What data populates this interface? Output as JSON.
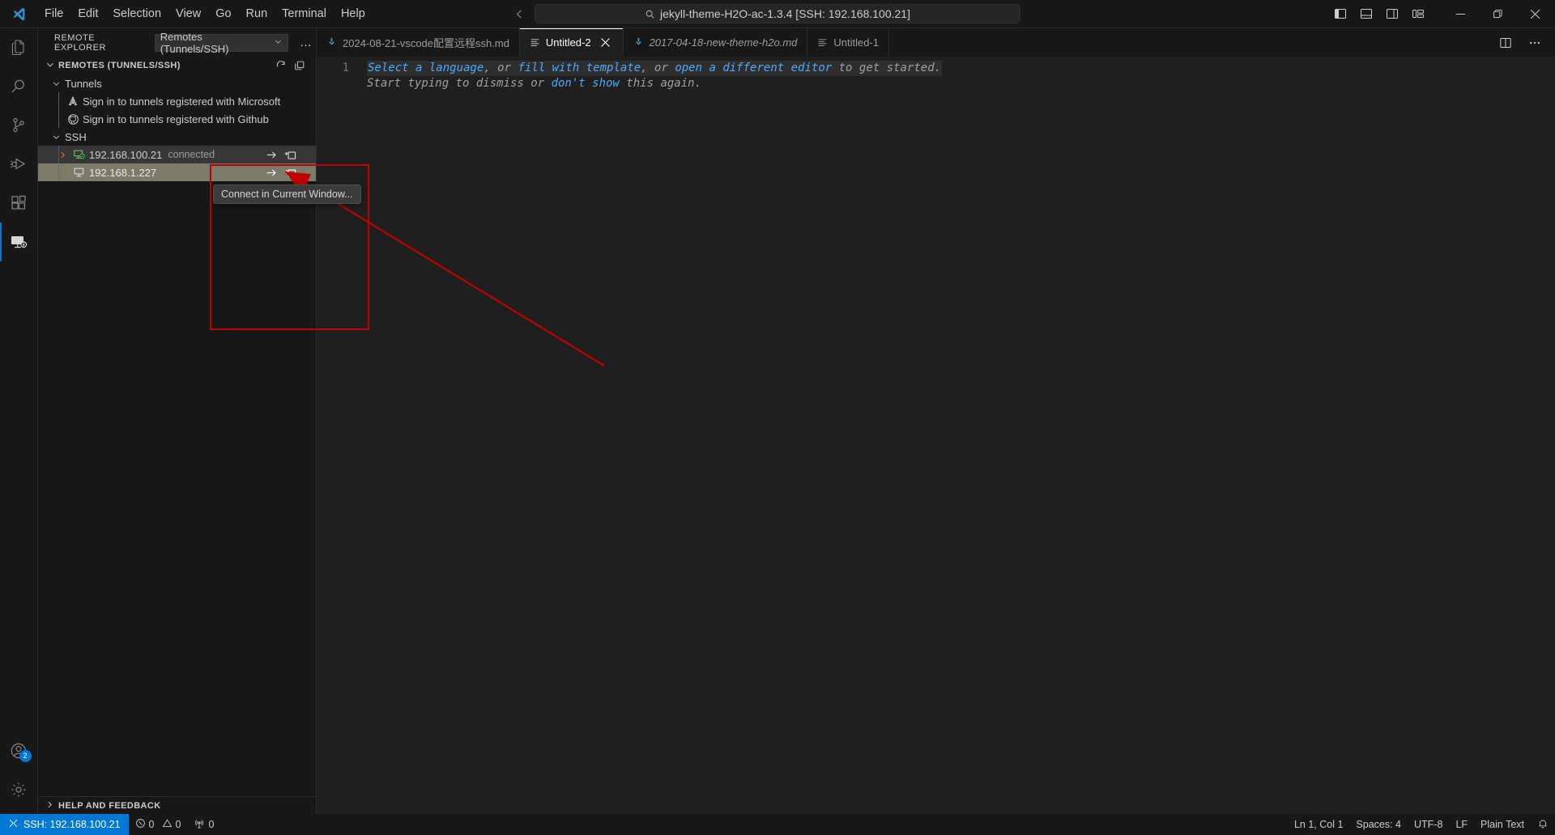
{
  "titlebar": {
    "logo": "vscode-logo",
    "menus": [
      "File",
      "Edit",
      "Selection",
      "View",
      "Go",
      "Run",
      "Terminal",
      "Help"
    ],
    "nav_back": "back-arrow-icon",
    "nav_forward": "forward-arrow-icon",
    "command_center": {
      "icon": "search-icon",
      "text": "jekyll-theme-H2O-ac-1.3.4 [SSH: 192.168.100.21]"
    },
    "layout_buttons": [
      "toggle-primary-sidebar-icon",
      "toggle-panel-icon",
      "toggle-secondary-sidebar-icon",
      "customize-layout-icon"
    ],
    "window_controls": [
      "minimize",
      "restore",
      "close"
    ]
  },
  "activitybar": {
    "items": [
      {
        "name": "explorer",
        "icon": "files-icon",
        "active": false
      },
      {
        "name": "search",
        "icon": "search-icon",
        "active": false
      },
      {
        "name": "source-control",
        "icon": "source-control-icon",
        "active": false
      },
      {
        "name": "run-and-debug",
        "icon": "run-debug-icon",
        "active": false
      },
      {
        "name": "extensions",
        "icon": "extensions-icon",
        "active": false
      },
      {
        "name": "remote-explorer",
        "icon": "remote-explorer-icon",
        "active": true
      }
    ],
    "bottom": [
      {
        "name": "accounts",
        "icon": "account-icon",
        "badge": "2"
      },
      {
        "name": "manage",
        "icon": "gear-icon",
        "badge": ""
      }
    ]
  },
  "sidebar": {
    "title": "REMOTE EXPLORER",
    "dropdown_label": "Remotes (Tunnels/SSH)",
    "dropdown_chevron": "chevron-down-icon",
    "more_actions": "…",
    "section": {
      "title": "REMOTES (TUNNELS/SSH)",
      "chevron": "chevron-down-icon",
      "actions": [
        "refresh-icon",
        "new-remote-icon"
      ]
    },
    "groups": [
      {
        "label": "Tunnels",
        "chevron": "chevron-down-icon",
        "children": [
          {
            "label": "Sign in to tunnels registered with Microsoft",
            "icon": "microsoft-icon"
          },
          {
            "label": "Sign in to tunnels registered with Github",
            "icon": "github-icon"
          }
        ]
      },
      {
        "label": "SSH",
        "chevron": "chevron-down-icon",
        "children": [
          {
            "label": "192.168.100.21",
            "description": "connected",
            "icon": "remote-connected-icon",
            "chevron": "chevron-right-icon",
            "state": "hovered",
            "actions": [
              "connect-in-current-window-icon",
              "connect-in-new-window-icon"
            ]
          },
          {
            "label": "192.168.1.227",
            "description": "",
            "icon": "remote-icon",
            "chevron": "",
            "state": "selected",
            "actions": [
              "connect-in-current-window-icon",
              "connect-in-new-window-icon"
            ]
          }
        ]
      }
    ],
    "help_and_feedback": {
      "label": "HELP AND FEEDBACK",
      "chevron": "chevron-right-icon"
    }
  },
  "tooltip": {
    "text": "Connect in Current Window..."
  },
  "annotation": {
    "rect_color": "#c00000",
    "arrow_color": "#c00000"
  },
  "tabs": [
    {
      "label": "2024-08-21-vscode配置远程ssh.md",
      "icon": "markdown-icon",
      "active": false,
      "preview": false,
      "closable": false
    },
    {
      "label": "Untitled-2",
      "icon": "plaintext-icon",
      "active": true,
      "preview": false,
      "closable": true
    },
    {
      "label": "2017-04-18-new-theme-h2o.md",
      "icon": "markdown-icon",
      "active": false,
      "preview": true,
      "closable": false
    },
    {
      "label": "Untitled-1",
      "icon": "plaintext-icon",
      "active": false,
      "preview": false,
      "closable": false
    }
  ],
  "tabs_right_actions": [
    "split-editor-icon",
    "more-actions-icon"
  ],
  "editor": {
    "line_number": "1",
    "watermark_line1": [
      {
        "text": "Select a language",
        "style": "link"
      },
      {
        "text": ", or ",
        "style": "dim"
      },
      {
        "text": "fill with template",
        "style": "link"
      },
      {
        "text": ", or ",
        "style": "dim"
      },
      {
        "text": "open a different editor",
        "style": "link"
      },
      {
        "text": " to get started.",
        "style": "dim"
      }
    ],
    "watermark_line2": [
      {
        "text": "Start typing to dismiss or ",
        "style": "dim"
      },
      {
        "text": "don't show",
        "style": "link"
      },
      {
        "text": " this again.",
        "style": "dim"
      }
    ]
  },
  "statusbar": {
    "remote": {
      "icon": "remote-indicator-icon",
      "label": "SSH: 192.168.100.21",
      "color": "#0078d4"
    },
    "problems": {
      "errors_icon": "error-icon",
      "errors": "0",
      "warnings_icon": "warning-icon",
      "warnings": "0"
    },
    "ports": {
      "icon": "radio-tower-icon",
      "count": "0"
    },
    "right": [
      {
        "name": "editor-position",
        "label": "Ln 1, Col 1"
      },
      {
        "name": "editor-indentation",
        "label": "Spaces: 4"
      },
      {
        "name": "editor-encoding",
        "label": "UTF-8"
      },
      {
        "name": "editor-eol",
        "label": "LF"
      },
      {
        "name": "editor-language",
        "label": "Plain Text"
      },
      {
        "name": "notifications",
        "label": "",
        "icon": "bell-icon"
      }
    ]
  }
}
